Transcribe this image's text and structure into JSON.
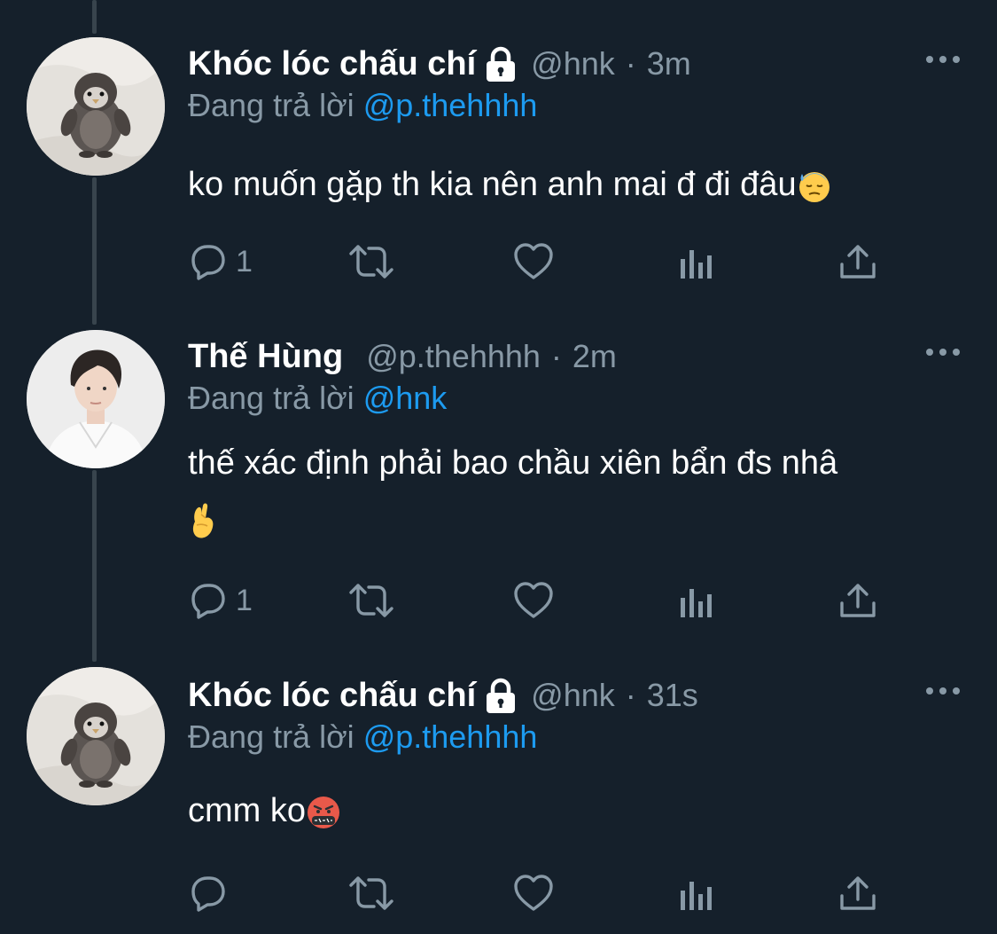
{
  "tweets": [
    {
      "display_name": "Khóc lóc chấu chí",
      "handle": "@hnk",
      "dot": "·",
      "time": "3m",
      "reply_prefix": "Đang trả lời",
      "reply_to": "@p.thehhhh",
      "text": "ko muốn gặp th kia nên anh mai đ đi đâu",
      "emoji": "downcast-face-with-sweat",
      "reply_count": "1",
      "locked": true,
      "avatar": "penguin-plush"
    },
    {
      "display_name": "Thế Hùng",
      "handle": "@p.thehhhh",
      "dot": "·",
      "time": "2m",
      "reply_prefix": "Đang trả lời",
      "reply_to": "@hnk",
      "text": "thế xác định phải bao chầu xiên bẩn đs nhâ",
      "emoji": "crossed-fingers",
      "reply_count": "1",
      "locked": false,
      "avatar": "person-white-shirt"
    },
    {
      "display_name": "Khóc lóc chấu chí",
      "handle": "@hnk",
      "dot": "·",
      "time": "31s",
      "reply_prefix": "Đang trả lời",
      "reply_to": "@p.thehhhh",
      "text": "cmm ko",
      "emoji": "face-with-symbols-on-mouth",
      "reply_count": "",
      "locked": true,
      "avatar": "penguin-plush"
    }
  ],
  "colors": {
    "background": "#15202b",
    "secondary_text": "#8899a6",
    "link": "#1d9bf0",
    "thread_line": "#38444d"
  },
  "icons": [
    "reply-icon",
    "retweet-icon",
    "like-icon",
    "analytics-icon",
    "share-icon",
    "more-icon",
    "lock-icon"
  ]
}
